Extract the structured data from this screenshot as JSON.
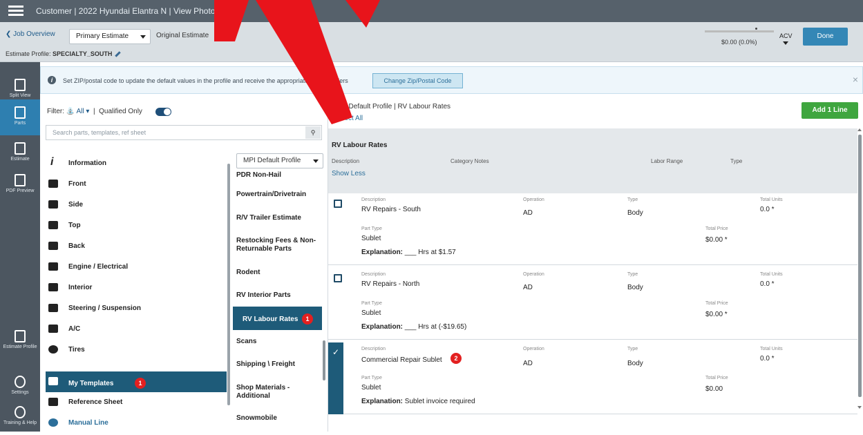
{
  "header": {
    "title": "Customer | 2022 Hyundai Elantra N | View Photos ↗"
  },
  "subbar": {
    "back_label": "Job Overview",
    "estimate_select": "Primary Estimate",
    "original_label": "Original Estimate",
    "profile_label": "Estimate Profile:",
    "profile_value": "SPECIALTY_SOUTH",
    "total": "$0.00 (0.0%)",
    "acv_label": "ACV",
    "done_label": "Done"
  },
  "rail": {
    "items": [
      {
        "label": "Split View"
      },
      {
        "label": "Parts"
      },
      {
        "label": "Estimate"
      },
      {
        "label": "PDF Preview"
      },
      {
        "label": "Estimate Profile"
      },
      {
        "label": "Settings"
      },
      {
        "label": "Training & Help"
      }
    ]
  },
  "banner": {
    "text": "Set ZIP/postal code to update the default values in the profile and receive the appropriate part providers",
    "button": "Change Zip/Postal Code",
    "close": "×"
  },
  "filter": {
    "label": "Filter:",
    "all": "All",
    "qualified": "Qualified Only"
  },
  "search": {
    "placeholder": "Search parts, templates, ref sheet"
  },
  "categories": [
    {
      "label": "Information"
    },
    {
      "label": "Front"
    },
    {
      "label": "Side"
    },
    {
      "label": "Top"
    },
    {
      "label": "Back"
    },
    {
      "label": "Engine / Electrical"
    },
    {
      "label": "Interior"
    },
    {
      "label": "Steering / Suspension"
    },
    {
      "label": "A/C"
    },
    {
      "label": "Tires"
    },
    {
      "label": "My Templates",
      "badge": "1"
    },
    {
      "label": "Reference Sheet"
    },
    {
      "label": "Manual Line"
    }
  ],
  "templates": {
    "profile_select": "MPI Default Profile",
    "items": [
      {
        "label": "PDR Non-Hail"
      },
      {
        "label": "Powertrain/Drivetrain"
      },
      {
        "label": "R/V Trailer Estimate"
      },
      {
        "label": "Restocking Fees & Non-Returnable Parts"
      },
      {
        "label": "Rodent"
      },
      {
        "label": "RV Interior Parts"
      },
      {
        "label": "RV Labour Rates",
        "badge": "1"
      },
      {
        "label": "Scans"
      },
      {
        "label": "Shipping \\ Freight"
      },
      {
        "label": "Shop Materials - Additional"
      },
      {
        "label": "Snowmobile"
      }
    ]
  },
  "right": {
    "heading": "MPI Default Profile | RV Labour Rates",
    "select_all": "Select All",
    "add_line": "Add 1 Line",
    "group_title": "RV Labour Rates",
    "col_description": "Description",
    "col_category_notes": "Category Notes",
    "col_labor_range": "Labor Range",
    "col_type": "Type",
    "show_less": "Show Less",
    "field_labels": {
      "description": "Description",
      "operation": "Operation",
      "type": "Type",
      "total_units": "Total Units",
      "part_type": "Part Type",
      "total_price": "Total Price",
      "explanation": "Explanation:"
    },
    "lines": [
      {
        "description": "RV Repairs - South",
        "operation": "AD",
        "type": "Body",
        "total_units": "0.0 *",
        "part_type": "Sublet",
        "total_price": "$0.00 *",
        "explanation": "___ Hrs at $1.57",
        "checked": false
      },
      {
        "description": "RV Repairs - North",
        "operation": "AD",
        "type": "Body",
        "total_units": "0.0 *",
        "part_type": "Sublet",
        "total_price": "$0.00 *",
        "explanation": "___ Hrs at (-$19.65)",
        "checked": false
      },
      {
        "description": "Commercial Repair Sublet",
        "operation": "AD",
        "type": "Body",
        "total_units": "0.0 *",
        "part_type": "Sublet",
        "total_price": "$0.00",
        "explanation": "Sublet invoice required",
        "checked": true,
        "badge": "2"
      }
    ]
  },
  "colors": {
    "accent": "#2e7fb0",
    "selected": "#1e5b79",
    "add_button": "#3fa63f",
    "badge": "#e32020"
  }
}
